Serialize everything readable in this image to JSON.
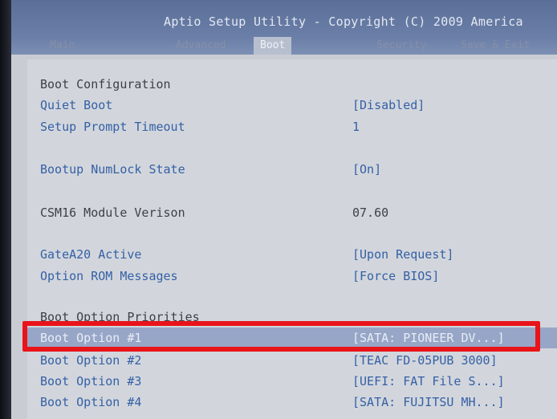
{
  "header": {
    "title": "Aptio Setup Utility - Copyright (C) 2009 America",
    "tabs": [
      "Main",
      "Advanced",
      "Boot",
      "Security",
      "Save & Exit"
    ],
    "active_tab": "Boot"
  },
  "boot": {
    "section_title": "Boot Configuration",
    "quiet_boot": {
      "label": "Quiet Boot",
      "value": "[Disabled]"
    },
    "setup_prompt_timeout": {
      "label": "Setup Prompt Timeout",
      "value": "1"
    },
    "bootup_numlock": {
      "label": "Bootup NumLock State",
      "value": "[On]"
    },
    "csm16": {
      "label": "CSM16 Module Verison",
      "value": "07.60"
    },
    "gatea20": {
      "label": "GateA20 Active",
      "value": "[Upon Request]"
    },
    "option_rom": {
      "label": "Option ROM Messages",
      "value": "[Force BIOS]"
    },
    "priorities_title": "Boot Option Priorities",
    "boot_options": [
      {
        "label": "Boot Option #1",
        "value": "[SATA: PIONEER DV...]"
      },
      {
        "label": "Boot Option #2",
        "value": "[TEAC FD-05PUB 3000]"
      },
      {
        "label": "Boot Option #3",
        "value": "[UEFI: FAT File S...]"
      },
      {
        "label": "Boot Option #4",
        "value": "[SATA: FUJITSU MH...]"
      }
    ]
  },
  "colors": {
    "header_blue": "#6b7fa8",
    "label_blue": "#3560a5",
    "selection": "#97a6c7",
    "highlight_red": "#e8141a"
  }
}
